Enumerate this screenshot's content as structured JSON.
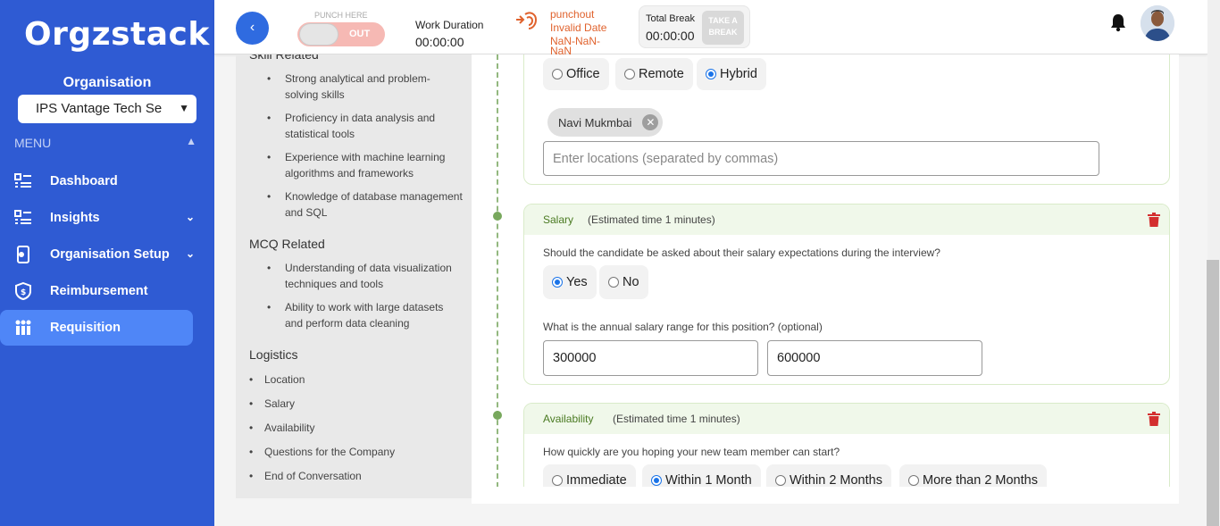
{
  "sidebar": {
    "logo": "Orgzstack",
    "org_label": "Organisation",
    "org_selected": "IPS Vantage Tech Se",
    "menu_label": "MENU",
    "items": [
      {
        "label": "Dashboard",
        "icon": "list-icon"
      },
      {
        "label": "Insights",
        "icon": "list-icon"
      },
      {
        "label": "Organisation Setup",
        "icon": "settings-phone-icon"
      },
      {
        "label": "Reimbursement",
        "icon": "shield-money-icon"
      },
      {
        "label": "Requisition",
        "icon": "people-icon"
      }
    ]
  },
  "topbar": {
    "punch_here": "PUNCH HERE",
    "punch_state": "OUT",
    "work_duration_label": "Work Duration",
    "work_duration_value": "00:00:00",
    "punchout_line1": "punchout",
    "punchout_line2": "Invalid Date",
    "punchout_line3": "NaN-NaN-",
    "punchout_line4": "NaN",
    "total_break_label": "Total Break",
    "total_break_value": "00:00:00",
    "take_break": "TAKE A BREAK"
  },
  "left_panel": {
    "skill_head": "Skill Related",
    "skills": [
      "Strong analytical and problem-solving skills",
      "Proficiency in data analysis and statistical tools",
      "Experience with machine learning algorithms and frameworks",
      "Knowledge of database management and SQL"
    ],
    "mcq_head": "MCQ Related",
    "mcq": [
      "Understanding of data visualization techniques and tools",
      "Ability to work with large datasets and perform data cleaning"
    ],
    "logistics_head": "Logistics",
    "logistics": [
      "Location",
      "Salary",
      "Availability",
      "Questions for the Company",
      "End of Conversation"
    ]
  },
  "location_card": {
    "options": [
      "Office",
      "Remote",
      "Hybrid"
    ],
    "selected": "Hybrid",
    "chip": "Navi Mukmbai",
    "placeholder": "Enter locations (separated by commas)"
  },
  "salary_card": {
    "title": "Salary",
    "time": "(Estimated time 1 minutes)",
    "question": "Should the candidate be asked about their salary expectations during the interview?",
    "options": [
      "Yes",
      "No"
    ],
    "selected": "Yes",
    "range_question": "What is the annual salary range for this position? (optional)",
    "min": "300000",
    "max": "600000"
  },
  "availability_card": {
    "title": "Availability",
    "time": "(Estimated time 1 minutes)",
    "question": "How quickly are you hoping your new team member can start?",
    "options": [
      "Immediate",
      "Within 1 Month",
      "Within 2 Months",
      "More than 2 Months"
    ],
    "selected": "Within 1 Month"
  },
  "colors": {
    "sidebar": "#2f5bd3",
    "active_nav": "#4f86f7",
    "accent_green": "#4a7a22",
    "delete_red": "#d32f2f",
    "punch_orange": "#e0622d"
  }
}
